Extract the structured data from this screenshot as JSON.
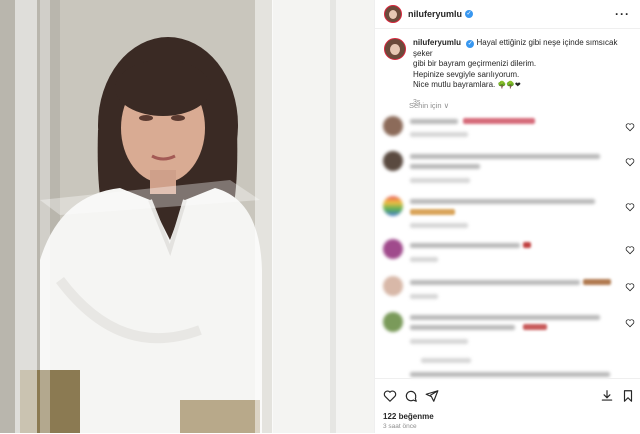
{
  "post": {
    "username": "niluferyumlu",
    "verified_symbol": "✓",
    "more_symbol": "···"
  },
  "caption": {
    "username": "niluferyumlu",
    "line1": "Hayal ettiğiniz gibi neşe içinde sımsıcak şeker",
    "line2": "gibi bir bayram geçirmenizi dilerim.",
    "line3": "Hepinize sevgiyle sarılıyorum.",
    "line4": "Nice mutlu bayramlara.",
    "emojis": "🌳🌳❤",
    "time": "3s"
  },
  "comments": {
    "sort_label": "Senin için ∨"
  },
  "footer": {
    "likes": "122 beğenme",
    "posted": "3 saat önce"
  },
  "colors": {
    "accent": "#3897f0",
    "text": "#262626",
    "muted": "#8e8e8e",
    "heart": "#e0245e"
  },
  "icons": [
    "heart-icon",
    "comment-icon",
    "share-icon",
    "save-icon",
    "more-icon",
    "verified-icon"
  ]
}
